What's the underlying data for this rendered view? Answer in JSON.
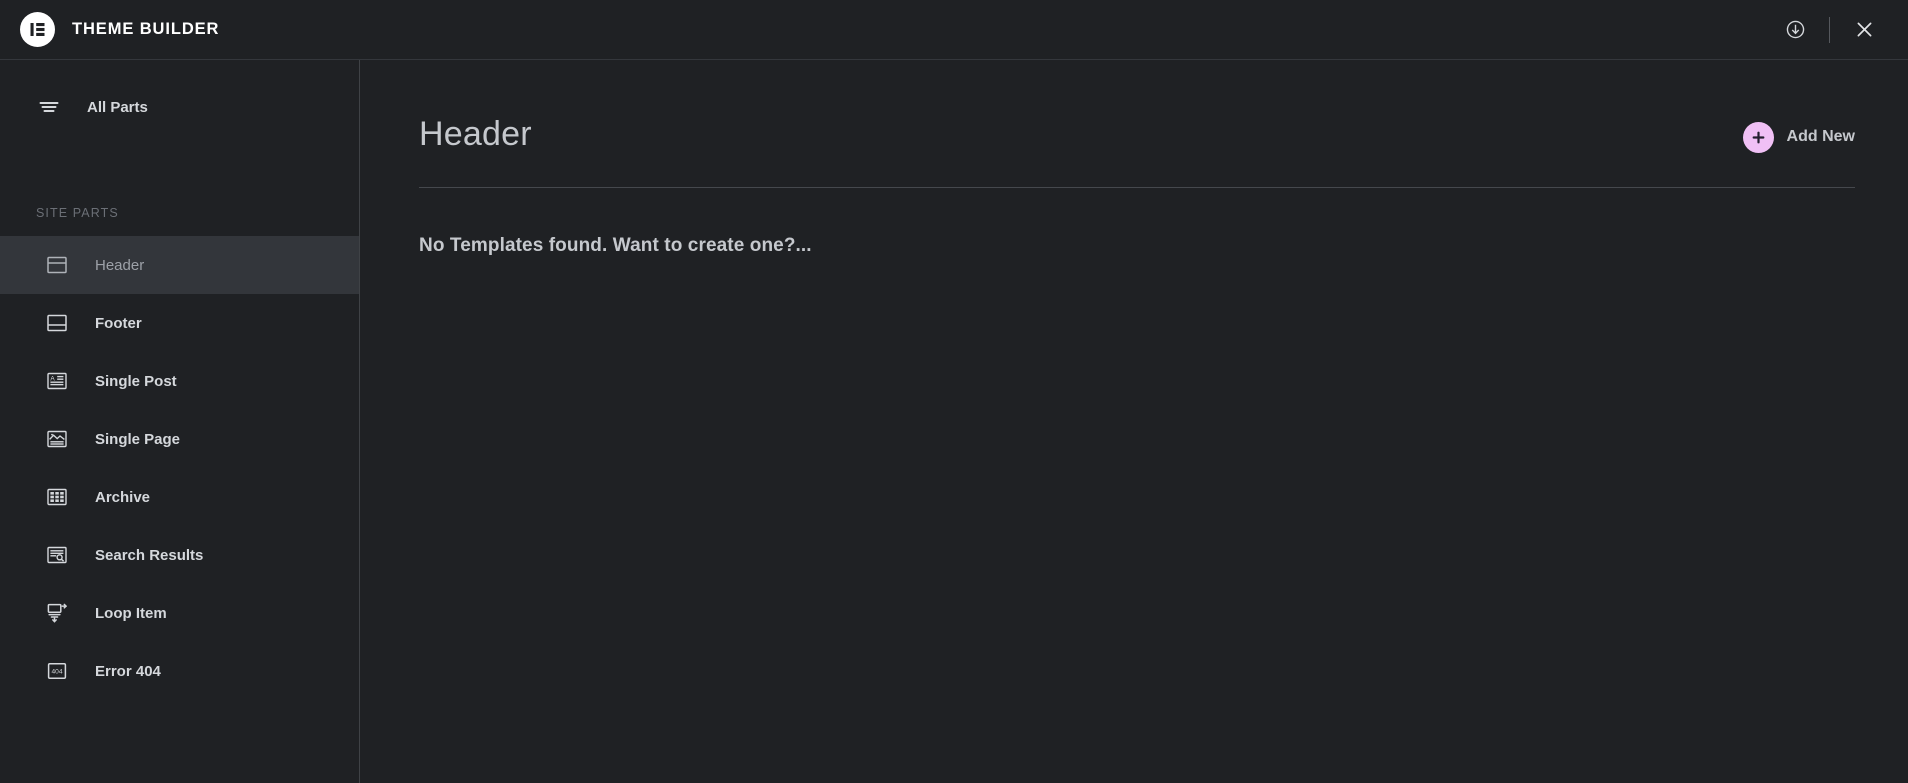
{
  "window": {
    "brand_title": "THEME BUILDER",
    "logo_icon": "elementor-logo-icon"
  },
  "topbar": {
    "actions": [
      {
        "name": "import-export-icon",
        "label": "Import / Export"
      },
      {
        "name": "close-icon",
        "label": "Close"
      }
    ]
  },
  "sidebar": {
    "all_parts": {
      "label": "All Parts",
      "icon": "filter-lines-icon"
    },
    "section_label": "Site Parts",
    "section_label_display": "SITE PARTS",
    "items": [
      {
        "label": "Header",
        "icon": "header-layout-icon",
        "active": true
      },
      {
        "label": "Footer",
        "icon": "footer-layout-icon",
        "active": false
      },
      {
        "label": "Single Post",
        "icon": "single-post-icon",
        "active": false
      },
      {
        "label": "Single Page",
        "icon": "single-page-icon",
        "active": false
      },
      {
        "label": "Archive",
        "icon": "archive-grid-icon",
        "active": false
      },
      {
        "label": "Search Results",
        "icon": "search-results-icon",
        "active": false
      },
      {
        "label": "Loop Item",
        "icon": "loop-item-icon",
        "active": false
      },
      {
        "label": "Error 404",
        "icon": "error-404-icon",
        "active": false
      }
    ]
  },
  "main": {
    "page_title": "Header",
    "add_new_label": "Add New",
    "empty_state_message": "No Templates found. Want to create one?..."
  },
  "colors": {
    "app_background": "#1f2124",
    "sidebar_active_background": "#33363b",
    "accent_pink": "#f0c0f5",
    "text_primary": "#d5d8dc",
    "text_muted": "#6b6f76",
    "divider": "#45484d"
  }
}
